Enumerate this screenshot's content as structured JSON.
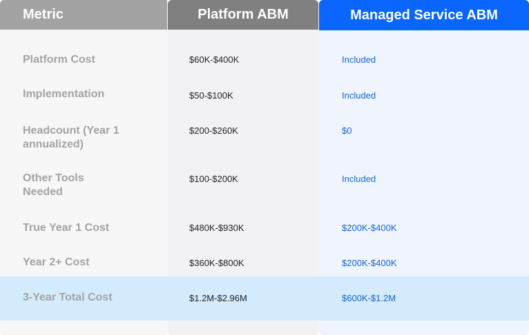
{
  "headers": {
    "metric": "Metric",
    "platform": "Platform ABM",
    "managed": "Managed Service ABM"
  },
  "rows": [
    {
      "metric": "Platform Cost",
      "platform": "$60K-$400K",
      "managed": "Included"
    },
    {
      "metric": "Implementation",
      "platform": "$50-$100K",
      "managed": "Included"
    },
    {
      "metric": "Headcount (Year 1 annualized)",
      "platform": "$200-$260K",
      "managed": "$0"
    },
    {
      "metric": "Other Tools Needed",
      "platform": "$100-$200K",
      "managed": "Included"
    },
    {
      "metric": "True Year 1 Cost",
      "platform": "$480K-$930K",
      "managed": "$200K-$400K"
    },
    {
      "metric": "Year 2+ Cost",
      "platform": "$360K-$800K",
      "managed": "$200K-$400K"
    },
    {
      "metric": "3-Year Total Cost",
      "platform": "$1.2M-$2.96M",
      "managed": "$600K-$1.2M"
    }
  ],
  "colors": {
    "header_metric": "#a3a3a3",
    "header_platform": "#808080",
    "header_managed": "#0a66ff",
    "highlight_row": "#d4ebfd",
    "managed_text": "#1463d9"
  }
}
